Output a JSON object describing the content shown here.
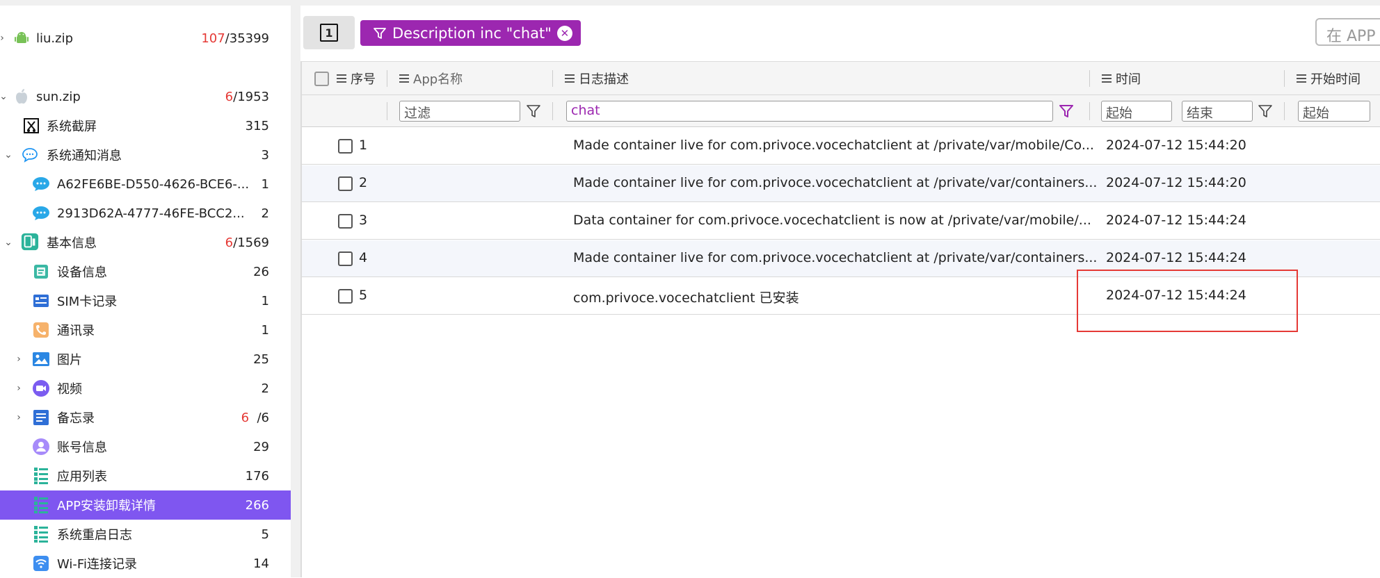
{
  "sidebar": {
    "items": [
      {
        "label": "liu.zip",
        "count_red": "107",
        "count_rest": "/35399",
        "icon": "android-icon"
      },
      {
        "label": "sun.zip",
        "count_red": "6",
        "count_rest": "/1953",
        "icon": "apple-icon"
      },
      {
        "label": "系统截屏",
        "count_red": "",
        "count_rest": "315",
        "icon": "screenshot-icon"
      },
      {
        "label": "系统通知消息",
        "count_red": "",
        "count_rest": "3",
        "icon": "chat-bubble-icon"
      },
      {
        "label": "A62FE6BE-D550-4626-BCE6-...",
        "count_red": "",
        "count_rest": "1",
        "icon": "message-icon"
      },
      {
        "label": "2913D62A-4777-46FE-BCC2...",
        "count_red": "",
        "count_rest": "2",
        "icon": "message-icon"
      },
      {
        "label": "基本信息",
        "count_red": "6",
        "count_rest": "/1569",
        "icon": "device-info-icon"
      },
      {
        "label": "设备信息",
        "count_red": "",
        "count_rest": "26",
        "icon": "device-icon"
      },
      {
        "label": "SIM卡记录",
        "count_red": "",
        "count_rest": "1",
        "icon": "sim-card-icon"
      },
      {
        "label": "通讯录",
        "count_red": "",
        "count_rest": "1",
        "icon": "contacts-icon"
      },
      {
        "label": "图片",
        "count_red": "",
        "count_rest": "25",
        "icon": "image-icon"
      },
      {
        "label": "视频",
        "count_red": "",
        "count_rest": "2",
        "icon": "video-icon"
      },
      {
        "label": "备忘录",
        "count_red": "6",
        "count_rest": "/6",
        "icon": "notes-icon"
      },
      {
        "label": "账号信息",
        "count_red": "",
        "count_rest": "29",
        "icon": "account-icon"
      },
      {
        "label": "应用列表",
        "count_red": "",
        "count_rest": "176",
        "icon": "app-list-icon"
      },
      {
        "label": "APP安装卸载详情",
        "count_red": "",
        "count_rest": "266",
        "icon": "app-list-icon"
      },
      {
        "label": "系统重启日志",
        "count_red": "",
        "count_rest": "5",
        "icon": "app-list-icon"
      },
      {
        "label": "Wi-Fi连接记录",
        "count_red": "",
        "count_rest": "14",
        "icon": "wifi-icon"
      }
    ]
  },
  "toolbar": {
    "square_label": "1",
    "filter_chip": "Description inc \"chat\"",
    "search_placeholder": "在 APP"
  },
  "table": {
    "headers": {
      "index": "序号",
      "app": "App名称",
      "desc": "日志描述",
      "time": "时间",
      "start": "开始时间"
    },
    "filters": {
      "app": "过滤",
      "desc": "chat",
      "time_start": "起始",
      "time_end": "结束",
      "start_start": "起始"
    },
    "rows": [
      {
        "num": "1",
        "desc": "Made container live for com.privoce.vocechatclient at /private/var/mobile/Co...",
        "time": "2024-07-12 15:44:20"
      },
      {
        "num": "2",
        "desc": "Made container live for com.privoce.vocechatclient at /private/var/containers...",
        "time": "2024-07-12 15:44:20"
      },
      {
        "num": "3",
        "desc": "Data container for com.privoce.vocechatclient is now at /private/var/mobile/...",
        "time": "2024-07-12 15:44:24"
      },
      {
        "num": "4",
        "desc": "Made container live for com.privoce.vocechatclient at /private/var/containers...",
        "time": "2024-07-12 15:44:24"
      },
      {
        "num": "5",
        "desc": "com.privoce.vocechatclient 已安装",
        "time": "2024-07-12 15:44:24"
      }
    ]
  },
  "colors": {
    "accent": "#7f56f0",
    "chip": "#9c27b0",
    "highlight_box": "#e53935"
  }
}
